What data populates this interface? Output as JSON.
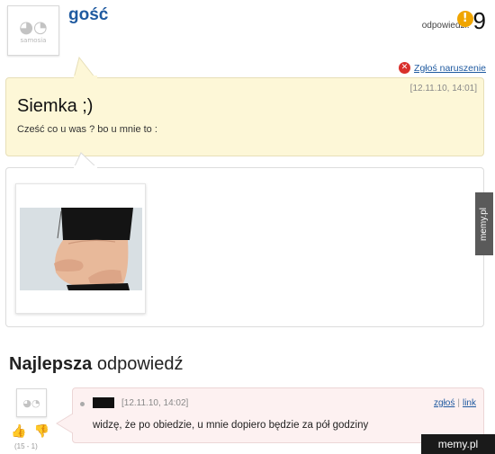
{
  "question": {
    "avatar_caption": "samosia",
    "username": "gość",
    "answers_label": "odpowiedzi:",
    "answers_count": "9",
    "report_label": "Zgłoś naruszenie",
    "timestamp": "[12.11.10, 14:01]",
    "title": "Siemka ;)",
    "body": "Cześć co u was ? bo u mnie to :"
  },
  "best_answer": {
    "heading_bold": "Najlepsza",
    "heading_rest": " odpowiedź",
    "timestamp": "[12.11.10, 14:02]",
    "report_label": "zgłoś",
    "link_label": "link",
    "text": "widzę, że po obiedzie, u mnie dopiero będzie za pół godziny",
    "vote_score": "(15 - 1)"
  },
  "icons": {
    "answers": "exclamation-icon",
    "report": "close-circle-icon",
    "vote_up": "thumbs-up-icon",
    "vote_down": "thumbs-down-icon"
  },
  "colors": {
    "username": "#1f5aa0",
    "question_bg": "#fdf7d7",
    "answer_bg": "#fdf1f1",
    "accent_orange": "#f0a500",
    "report_red": "#d9302c"
  },
  "watermarks": {
    "side": "memy.pl",
    "corner": "memy.pl"
  }
}
